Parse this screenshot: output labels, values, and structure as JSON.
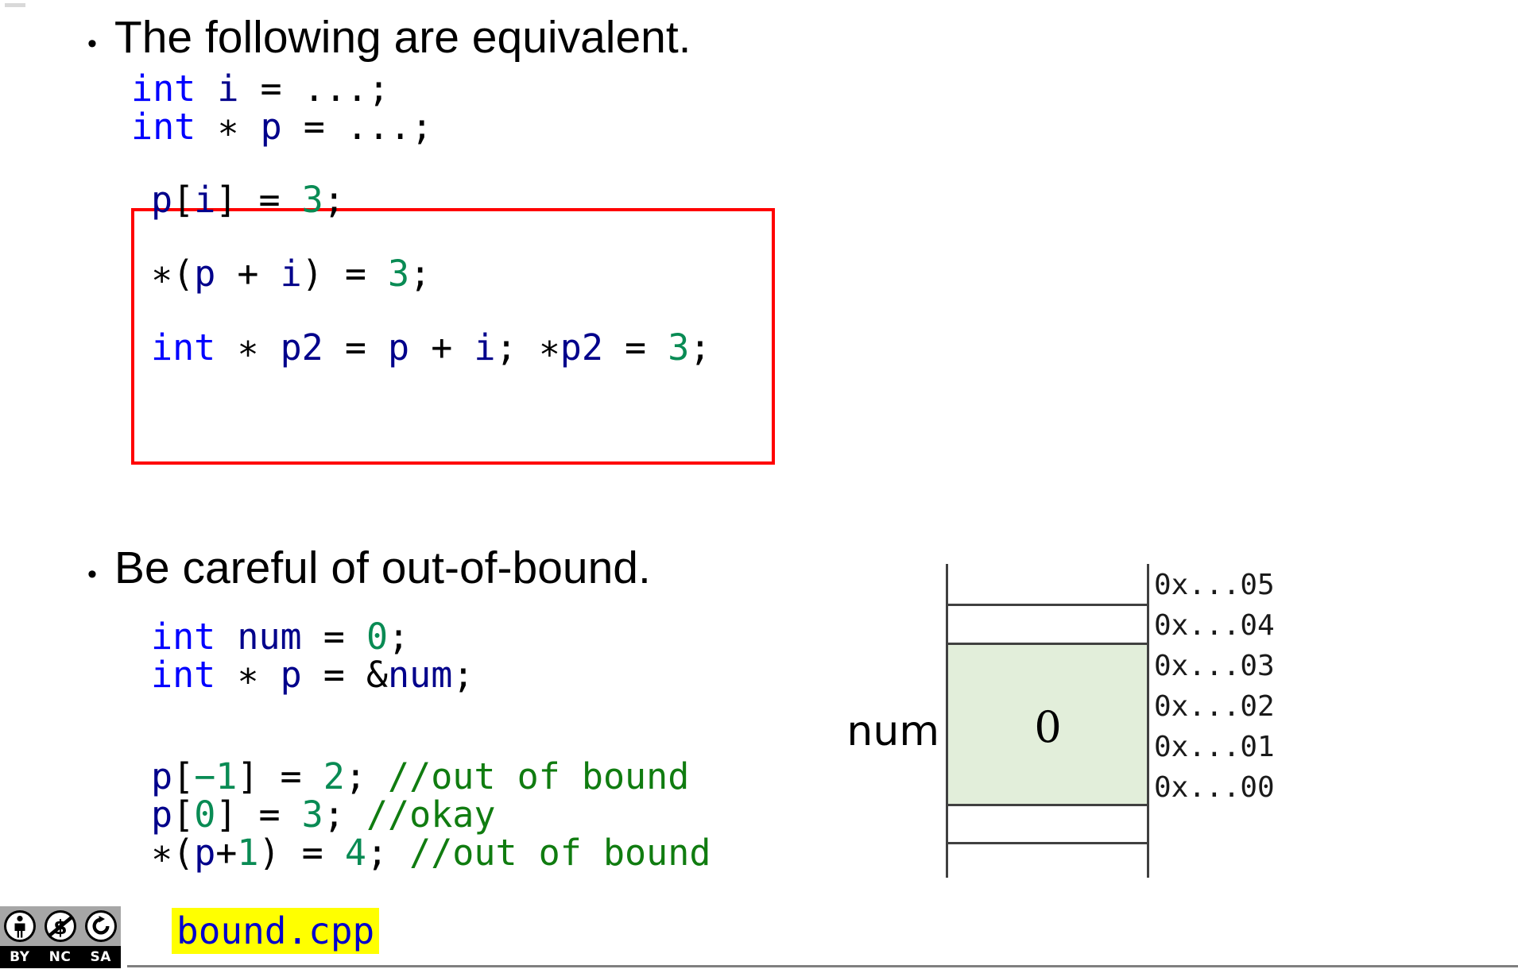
{
  "slide": {
    "bullets": [
      {
        "text": "The following are equivalent."
      },
      {
        "text": "Be careful of out-of-bound."
      }
    ],
    "code_intro": {
      "line1": {
        "kw": "int",
        "rest_a": " ",
        "id": "i",
        "rest_b": " = ...;"
      },
      "line2": {
        "kw": "int",
        "rest_a": " ",
        "op": "∗",
        "rest_b": " ",
        "id": "p",
        "rest_c": " = ...;"
      },
      "plain1": "int i = ...;",
      "plain2": "int * p = ...;"
    },
    "equivalent_box": {
      "lines": [
        {
          "plain": "p[i] = 3;"
        },
        {
          "plain": "*(p + i) = 3;"
        },
        {
          "plain": "int * p2 = p + i; *p2 = 3;"
        }
      ],
      "tokens": {
        "l1_id_p": "p",
        "l1_br_open": "[",
        "l1_id_i": "i",
        "l1_br_close": "]",
        "l1_assign": " = ",
        "l1_num": "3",
        "l1_semi": ";",
        "l2_star": "∗(",
        "l2_id_p": "p",
        "l2_plus": " + ",
        "l2_id_i": "i",
        "l2_close": ")",
        "l2_assign": " = ",
        "l2_num": "3",
        "l2_semi": ";",
        "l3_kw": "int",
        "l3_star": " ∗ ",
        "l3_id_p2": "p2",
        "l3_assign": " = ",
        "l3_id_p": "p",
        "l3_plus": " + ",
        "l3_id_i": "i",
        "l3_semi1": "; ",
        "l3_star2": "∗",
        "l3_id_p2b": "p2",
        "l3_assign2": " = ",
        "l3_num": "3",
        "l3_semi2": ";"
      }
    },
    "code_bound": {
      "plain": [
        "int num = 0;",
        "int * p = &num;",
        "",
        "p[-1] = 2; //out of bound",
        "p[0] = 3; //okay",
        "*(p+1) = 4; //out of bound"
      ],
      "tokens": {
        "b1_kw": "int",
        "b1_sp": " ",
        "b1_id": "num",
        "b1_assign": " = ",
        "b1_num": "0",
        "b1_semi": ";",
        "b2_kw": "int",
        "b2_star": " ∗ ",
        "b2_id_p": "p",
        "b2_assign": " = &",
        "b2_id_num": "num",
        "b2_semi": ";",
        "b3_id_p": "p",
        "b3_br_open": "[",
        "b3_num_idx": "−1",
        "b3_br_close": "]",
        "b3_assign": " = ",
        "b3_num": "2",
        "b3_semi": "; ",
        "b3_cmt": "//out of bound",
        "b4_id_p": "p",
        "b4_br_open": "[",
        "b4_num_idx": "0",
        "b4_br_close": "]",
        "b4_assign": " = ",
        "b4_num": "3",
        "b4_semi": "; ",
        "b4_cmt": "//okay",
        "b5_star": "∗(",
        "b5_id_p": "p",
        "b5_plus": "+",
        "b5_num_off": "1",
        "b5_close": ")",
        "b5_assign": " = ",
        "b5_num": "4",
        "b5_semi": "; ",
        "b5_cmt": "//out of bound"
      }
    },
    "memory_diagram": {
      "variable_label": "num",
      "cell_value": "0",
      "highlight_color": "#e2eeda",
      "addresses": [
        "0x...05",
        "0x...04",
        "0x...03",
        "0x...02",
        "0x...01",
        "0x...00"
      ]
    },
    "footer": {
      "file_name": "bound.cpp",
      "highlight_color": "#ffff00",
      "file_name_color": "#0000cd",
      "license": {
        "name": "CC BY-NC-SA",
        "labels": [
          "BY",
          "NC",
          "SA"
        ],
        "icons": [
          "cc-by-person-icon",
          "cc-nc-nocommercial-icon",
          "cc-sa-sharealike-icon"
        ]
      }
    }
  }
}
